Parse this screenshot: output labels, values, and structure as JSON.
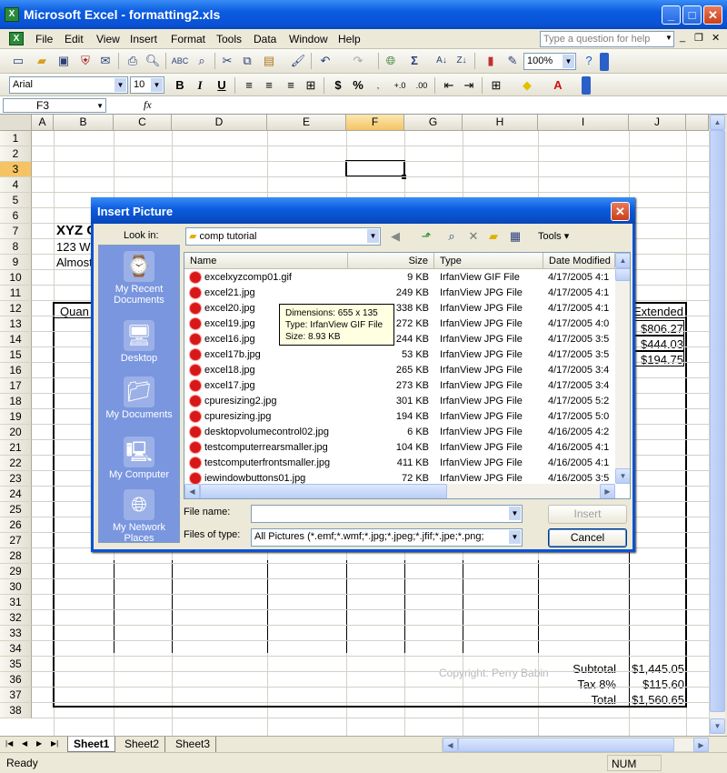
{
  "window": {
    "title": "Microsoft Excel - formatting2.xls",
    "icon_label": "X"
  },
  "menu": [
    "File",
    "Edit",
    "View",
    "Insert",
    "Format",
    "Tools",
    "Data",
    "Window",
    "Help"
  ],
  "help_box": {
    "placeholder": "Type a question for help"
  },
  "toolbar": {
    "zoom": "100%",
    "font": "Arial",
    "font_size": "10",
    "bold": "B",
    "italic": "I",
    "underline": "U",
    "currency": "$",
    "percent": "%",
    "sum": "Σ"
  },
  "formula": {
    "name_box": "F3",
    "fx": "fx"
  },
  "columns": [
    "A",
    "B",
    "C",
    "D",
    "E",
    "F",
    "G",
    "H",
    "I",
    "J"
  ],
  "rows": [
    "1",
    "2",
    "3",
    "4",
    "5",
    "6",
    "7",
    "8",
    "9",
    "10",
    "11",
    "12",
    "13",
    "14",
    "15",
    "16",
    "17",
    "18",
    "19",
    "20",
    "21",
    "22",
    "23",
    "24",
    "25",
    "26",
    "27",
    "28",
    "29",
    "30",
    "31",
    "32",
    "33",
    "34",
    "35",
    "36",
    "37",
    "38"
  ],
  "sheet": {
    "company": "XYZ C",
    "address": "123 W",
    "line3": "Almost",
    "header_quantity": "Quan",
    "header_extended": "Extended",
    "extended_values": [
      "$806.27",
      "$444.03",
      "$194.75"
    ],
    "subtotal_label": "Subtotal",
    "subtotal_value": "$1,445.05",
    "tax_label": "Tax 8%",
    "tax_value": "$115.60",
    "total_label": "Total",
    "total_value": "$1,560.65",
    "watermark": "Copyright: Perry Babin"
  },
  "sheet_tabs": [
    "Sheet1",
    "Sheet2",
    "Sheet3"
  ],
  "status": {
    "left": "Ready",
    "num": "NUM"
  },
  "dialog": {
    "title": "Insert Picture",
    "look_in_label": "Look in:",
    "look_in_value": "comp tutorial",
    "tools_label": "Tools",
    "places": [
      "My Recent Documents",
      "Desktop",
      "My Documents",
      "My Computer",
      "My Network Places"
    ],
    "columns": {
      "name": "Name",
      "size": "Size",
      "type": "Type",
      "date": "Date Modified"
    },
    "files": [
      {
        "name": "excelxyzcomp01.gif",
        "size": "9 KB",
        "type": "IrfanView GIF File",
        "date": "4/17/2005 4:1"
      },
      {
        "name": "excel21.jpg",
        "size": "249 KB",
        "type": "IrfanView JPG File",
        "date": "4/17/2005 4:1"
      },
      {
        "name": "excel20.jpg",
        "size": "338 KB",
        "type": "IrfanView JPG File",
        "date": "4/17/2005 4:1"
      },
      {
        "name": "excel19.jpg",
        "size": "272 KB",
        "type": "IrfanView JPG File",
        "date": "4/17/2005 4:0"
      },
      {
        "name": "excel16.jpg",
        "size": "244 KB",
        "type": "IrfanView JPG File",
        "date": "4/17/2005 3:5"
      },
      {
        "name": "excel17b.jpg",
        "size": "53 KB",
        "type": "IrfanView JPG File",
        "date": "4/17/2005 3:5"
      },
      {
        "name": "excel18.jpg",
        "size": "265 KB",
        "type": "IrfanView JPG File",
        "date": "4/17/2005 3:4"
      },
      {
        "name": "excel17.jpg",
        "size": "273 KB",
        "type": "IrfanView JPG File",
        "date": "4/17/2005 3:4"
      },
      {
        "name": "cpuresizing2.jpg",
        "size": "301 KB",
        "type": "IrfanView JPG File",
        "date": "4/17/2005 5:2"
      },
      {
        "name": "cpuresizing.jpg",
        "size": "194 KB",
        "type": "IrfanView JPG File",
        "date": "4/17/2005 5:0"
      },
      {
        "name": "desktopvolumecontrol02.jpg",
        "size": "6 KB",
        "type": "IrfanView JPG File",
        "date": "4/16/2005 4:2"
      },
      {
        "name": "testcomputerrearsmaller.jpg",
        "size": "104 KB",
        "type": "IrfanView JPG File",
        "date": "4/16/2005 4:1"
      },
      {
        "name": "testcomputerfrontsmaller.jpg",
        "size": "411 KB",
        "type": "IrfanView JPG File",
        "date": "4/16/2005 4:1"
      },
      {
        "name": "iewindowbuttons01.jpg",
        "size": "72 KB",
        "type": "IrfanView JPG File",
        "date": "4/16/2005 3:5"
      }
    ],
    "tooltip": [
      "Dimensions: 655 x 135",
      "Type: IrfanView GIF File",
      "Size: 8.93 KB"
    ],
    "file_name_label": "File name:",
    "file_name_value": "",
    "file_type_label": "Files of type:",
    "file_type_value": "All Pictures (*.emf;*.wmf;*.jpg;*.jpeg;*.jfif;*.jpe;*.png;",
    "insert_label": "Insert",
    "cancel_label": "Cancel"
  }
}
